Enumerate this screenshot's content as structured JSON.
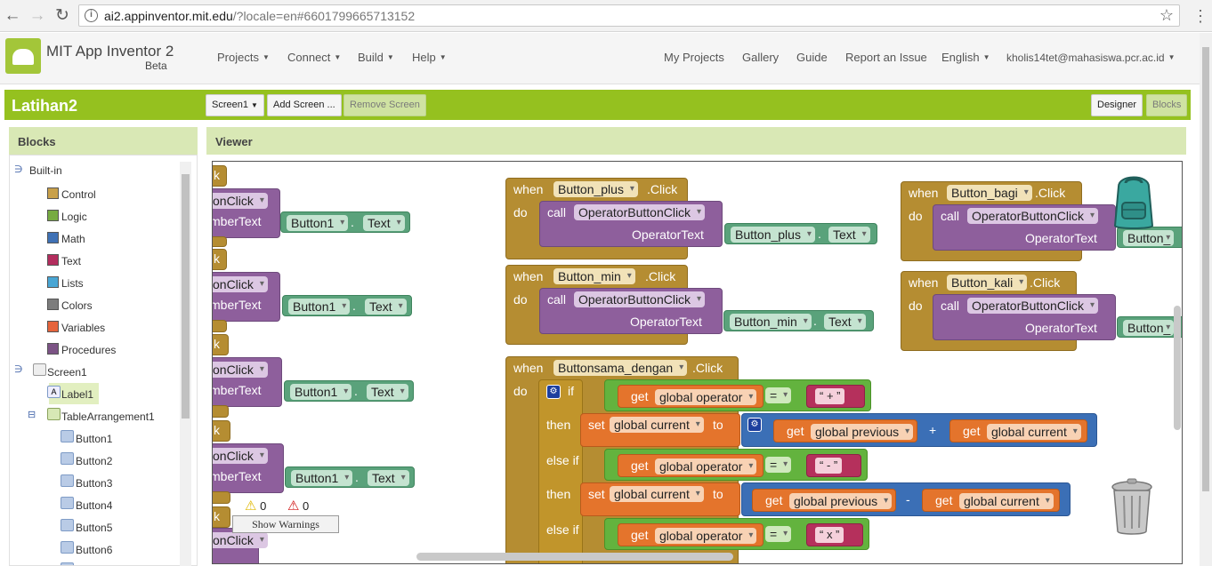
{
  "browser": {
    "url_host": "ai2.appinventor.mit.edu",
    "url_rest": "/?locale=en#6601799665713152"
  },
  "header": {
    "brand": "MIT App Inventor 2",
    "beta": "Beta",
    "menus": [
      "Projects",
      "Connect",
      "Build",
      "Help"
    ],
    "links": [
      "My Projects",
      "Gallery",
      "Guide",
      "Report an Issue"
    ],
    "language": "English",
    "user": "kholis14tet@mahasiswa.pcr.ac.id"
  },
  "project": {
    "name": "Latihan2",
    "screen_select": "Screen1",
    "add_screen": "Add Screen ...",
    "remove_screen": "Remove Screen",
    "designer": "Designer",
    "blocks": "Blocks"
  },
  "blocks_panel": {
    "title": "Blocks",
    "builtin": "Built-in",
    "builtin_items": [
      "Control",
      "Logic",
      "Math",
      "Text",
      "Lists",
      "Colors",
      "Variables",
      "Procedures"
    ],
    "screen": "Screen1",
    "label1": "Label1",
    "table": "TableArrangement1",
    "buttons": [
      "Button1",
      "Button2",
      "Button3",
      "Button4",
      "Button5",
      "Button6"
    ]
  },
  "viewer": {
    "title": "Viewer",
    "warnings_count": "0",
    "errors_count": "0",
    "show_warnings": "Show Warnings",
    "kw": {
      "when": "when",
      "do": "do",
      "call": "call",
      "click": ".Click",
      "if": "if",
      "then": "then",
      "else_if": "else if",
      "set": "set",
      "to": "to",
      "get": "get",
      "dot": "."
    },
    "left_partial": {
      "k": "k",
      "onclick": "onClick",
      "mbertext": "mberText",
      "button1": "Button1",
      "text": "Text"
    },
    "proc_name": "OperatorButtonClick",
    "param": "OperatorText",
    "text_prop": "Text",
    "buttons": {
      "plus": "Button_plus",
      "min": "Button_min",
      "bagi": "Button_bagi",
      "kali": "Button_kali",
      "sama": "Buttonsama_dengan",
      "cut": "Button_"
    },
    "vars": {
      "operator": "global operator",
      "current": "global current",
      "previous": "global previous"
    },
    "ops": {
      "eq": "=",
      "plus": "+",
      "minus": "-"
    },
    "texts": {
      "plus": "“ + ”",
      "minus": "“ - ”",
      "x": "“ x ”"
    }
  }
}
